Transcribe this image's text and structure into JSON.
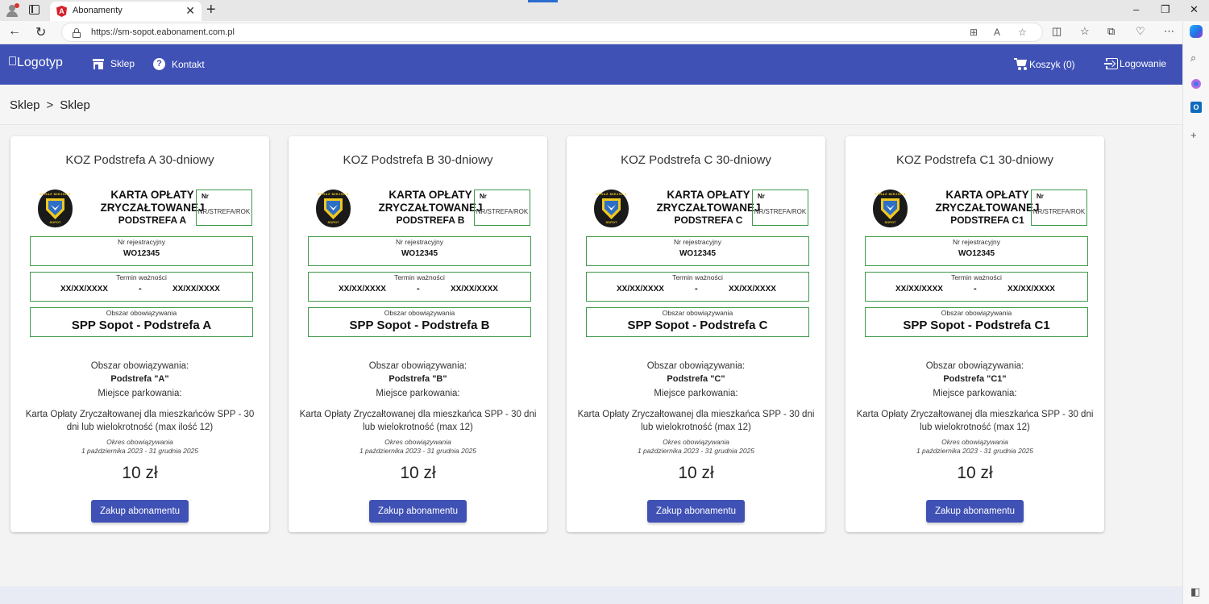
{
  "browser": {
    "tab_title": "Abonamenty",
    "tab_close": "✕",
    "new_tab": "+",
    "url": "https://sm-sopot.eabonament.com.pl",
    "win_minimize": "–",
    "win_restore": "❐",
    "win_close": "✕",
    "nav_back": "←",
    "nav_reload": "↻",
    "more_menu": "⋯"
  },
  "app": {
    "logo_alt": "Logotyp",
    "nav": {
      "shop": "Sklep",
      "contact": "Kontakt",
      "cart": "Koszyk (0)",
      "login": "Logowanie"
    }
  },
  "breadcrumb": [
    "Sklep",
    "Sklep"
  ],
  "pass_labels": {
    "heading_l1": "KARTA OPŁATY",
    "heading_l2": "ZRYCZAŁTOWANEJ",
    "nr_label": "Nr",
    "nr_value": "NR/STREFA/ROK",
    "reg_label": "Nr rejestracyjny",
    "reg_value": "WO12345",
    "validity_label": "Termin ważności",
    "validity_from": "XX/XX/XXXX",
    "validity_dash": "-",
    "validity_to": "XX/XX/XXXX",
    "area_label": "Obszar obowiązywania"
  },
  "card_labels": {
    "area_label": "Obszar obowiązywania:",
    "parking_label": "Miejsce parkowania:",
    "period_label": "Okres obowiązywania",
    "period_value": "1 października 2023 - 31 grudnia 2025",
    "price": "10 zł",
    "buy_button": "Zakup abonamentu"
  },
  "products": [
    {
      "title": "KOZ Podstrefa A 30-dniowy",
      "pass_subzone": "PODSTREFA A",
      "pass_area": "SPP Sopot - Podstrefa A",
      "area_value": "Podstrefa \"A\"",
      "description": "Karta Opłaty Zryczałtowanej dla mieszkańców SPP - 30 dni lub wielokrotność (max ilość 12)"
    },
    {
      "title": "KOZ Podstrefa B 30-dniowy",
      "pass_subzone": "PODSTREFA B",
      "pass_area": "SPP Sopot - Podstrefa B",
      "area_value": "Podstrefa \"B\"",
      "description": "Karta Opłaty Zryczałtowanej dla mieszkańca SPP - 30 dni lub wielokrotność (max 12)"
    },
    {
      "title": "KOZ Podstrefa C 30-dniowy",
      "pass_subzone": "PODSTREFA C",
      "pass_area": "SPP Sopot - Podstrefa C",
      "area_value": "Podstrefa \"C\"",
      "description": "Karta Opłaty Zryczałtowanej dla mieszkańca SPP - 30 dni lub wielokrotność (max 12)"
    },
    {
      "title": "KOZ Podstrefa C1 30-dniowy",
      "pass_subzone": "PODSTREFA C1",
      "pass_area": "SPP Sopot - Podstrefa C1",
      "area_value": "Podstrefa \"C1\"",
      "description": "Karta Opłaty Zryczałtowanej dla mieszkańca SPP - 30 dni lub wielokrotność (max 12)"
    }
  ],
  "colors": {
    "primary": "#3f51b5",
    "pass_border": "#3e9a4a",
    "background": "#f3f3f3"
  }
}
